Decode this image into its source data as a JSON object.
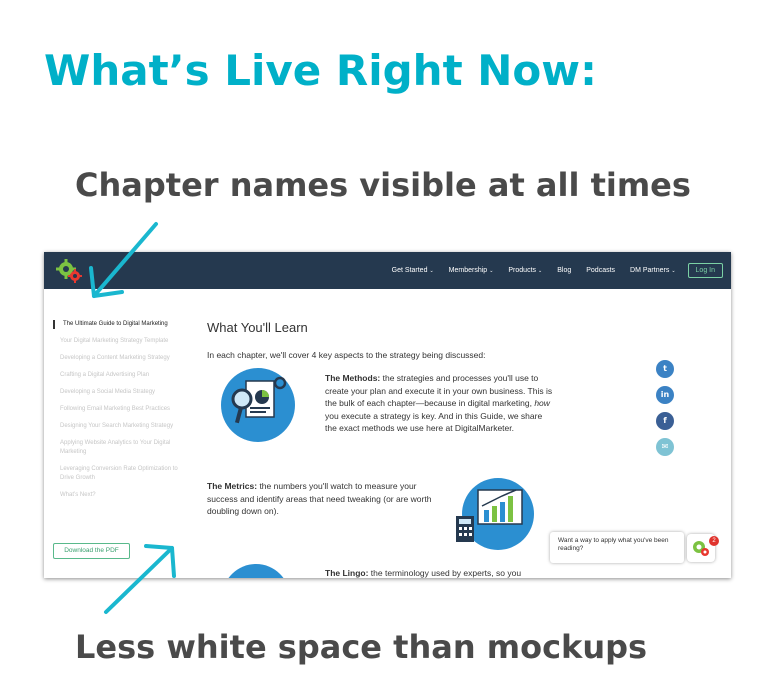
{
  "slide": {
    "headline": "What’s Live Right Now:",
    "caption_top": "Chapter names visible at all times",
    "caption_bottom": "Less white space than mockups"
  },
  "colors": {
    "headline": "#00b0c8",
    "navbar": "#25394f",
    "arrow": "#1ab7cf",
    "accent_green": "#59b98b"
  },
  "screenshot": {
    "nav": {
      "items": [
        {
          "label": "Get Started",
          "caret": "⌄"
        },
        {
          "label": "Membership",
          "caret": "⌄"
        },
        {
          "label": "Products",
          "caret": "⌄"
        },
        {
          "label": "Blog",
          "caret": ""
        },
        {
          "label": "Podcasts",
          "caret": ""
        },
        {
          "label": "DM Partners",
          "caret": "⌄"
        }
      ],
      "login": "Log In"
    },
    "sidebar": {
      "items": [
        "The Ultimate Guide to Digital Marketing",
        "Your Digital Marketing Strategy Template",
        "Developing a Content Marketing Strategy",
        "Crafting a Digital Advertising Plan",
        "Developing a Social Media Strategy",
        "Following Email Marketing Best Practices",
        "Designing Your Search Marketing Strategy",
        "Applying Website Analytics to Your Digital Marketing",
        "Leveraging Conversion Rate Optimization to Drive Growth",
        "What’s Next?"
      ],
      "pdf_button": "Download the PDF"
    },
    "main": {
      "title": "What You'll Learn",
      "intro": "In each chapter, we'll cover 4 key aspects to the strategy being discussed:",
      "methods_label": "The Methods:",
      "methods_text_1": " the strategies and processes you'll use to create your plan and execute it in your own business. This is the bulk of each chapter—because in digital marketing, ",
      "methods_em": "how",
      "methods_text_2": " you execute a strategy is key. And in this Guide, we share the exact methods we use here at DigitalMarketer.",
      "metrics_label": "The Metrics:",
      "metrics_text": " the numbers you'll watch to measure your success and identify areas that need tweaking (or are worth doubling down on).",
      "lingo_label": "The Lingo:",
      "lingo_text": " the terminology used by experts, so you"
    },
    "social_icons": [
      "twitter-icon",
      "linkedin-icon",
      "facebook-icon",
      "email-icon"
    ],
    "chat": {
      "text": "Want a way to apply what you've been reading?",
      "badge": "2"
    }
  }
}
